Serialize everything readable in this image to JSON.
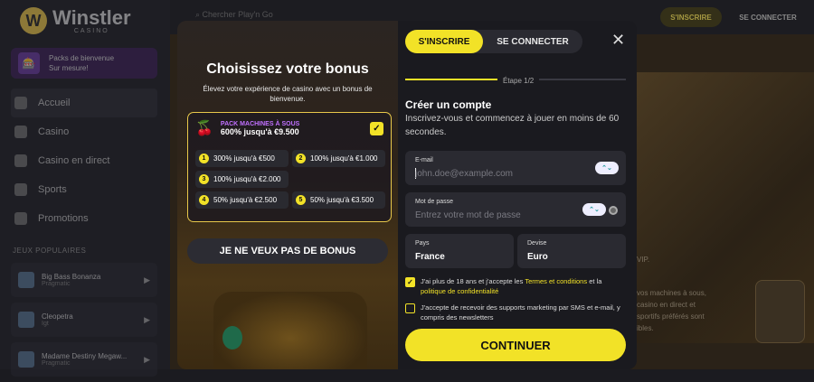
{
  "brand": {
    "name": "Winstler",
    "sub": "CASINO",
    "mark": "W"
  },
  "search": {
    "placeholder": "Chercher Play'n Go"
  },
  "topbar": {
    "register": "S'INSCRIRE",
    "login": "SE CONNECTER"
  },
  "sidebar": {
    "promo": {
      "line1": "Packs de bienvenue",
      "line2": "Sur mesure!"
    },
    "items": [
      {
        "label": "Accueil"
      },
      {
        "label": "Casino"
      },
      {
        "label": "Casino en direct"
      },
      {
        "label": "Sports"
      },
      {
        "label": "Promotions"
      }
    ],
    "section_title": "JEUX POPULAIRES",
    "games": [
      {
        "name": "Big Bass Bonanza",
        "provider": "Pragmatic"
      },
      {
        "name": "Cleopetra",
        "provider": "Igt"
      },
      {
        "name": "Madame Destiny Megaw...",
        "provider": "Pragmatic"
      }
    ]
  },
  "background": {
    "vip": "VIP.",
    "text": "vos machines à sous, casino en direct et sportifs préférés sont ibles."
  },
  "bonus": {
    "title": "Choisissez votre bonus",
    "subtitle": "Élevez votre expérience de casino avec un bonus de bienvenue.",
    "pack_label": "PACK MACHINES À SOUS",
    "pack_amount": "600% jusqu'à €9.500",
    "options": [
      {
        "num": "1",
        "text": "300% jusqu'à €500"
      },
      {
        "num": "2",
        "text": "100% jusqu'à €1.000"
      },
      {
        "num": "3",
        "text": "100% jusqu'à €2.000"
      },
      {
        "num": "4",
        "text": "50% jusqu'à €2.500"
      },
      {
        "num": "5",
        "text": "50% jusqu'à €3.500"
      }
    ],
    "no_bonus": "JE NE VEUX PAS DE BONUS"
  },
  "form": {
    "tab_register": "S'INSCRIRE",
    "tab_login": "SE CONNECTER",
    "close": "✕",
    "step": "Étape 1/2",
    "progress": 0.5,
    "title": "Créer un compte",
    "subtitle": "Inscrivez-vous et commencez à jouer en moins de 60 secondes.",
    "email_label": "E-mail",
    "email_placeholder": "john.doe@example.com",
    "password_label": "Mot de passe",
    "password_placeholder": "Entrez votre mot de passe",
    "country_label": "Pays",
    "country_value": "France",
    "currency_label": "Devise",
    "currency_value": "Euro",
    "terms_pre": "J'ai plus de 18 ans et j'accepte les ",
    "terms_link": "Termes et conditions",
    "terms_mid": " et la ",
    "privacy_link": "politique de confidentialité",
    "marketing": "J'accepte de recevoir des supports marketing par SMS et e-mail, y compris des newsletters",
    "continue": "CONTINUER"
  },
  "colors": {
    "accent": "#f2e227",
    "purple": "#c070ff"
  }
}
